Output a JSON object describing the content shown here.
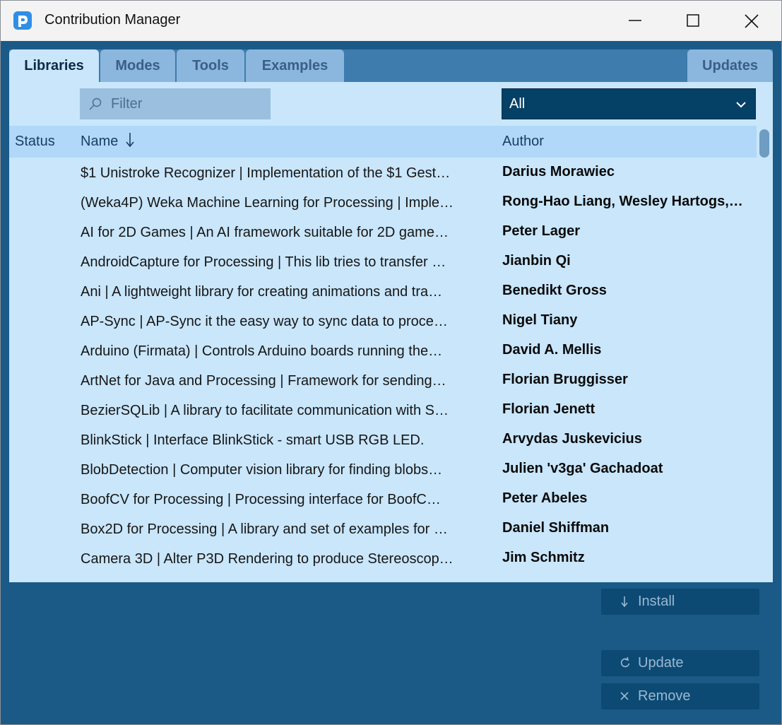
{
  "window": {
    "title": "Contribution Manager"
  },
  "tabs": {
    "libraries": "Libraries",
    "modes": "Modes",
    "tools": "Tools",
    "examples": "Examples",
    "updates": "Updates"
  },
  "filter": {
    "placeholder": "Filter"
  },
  "category": {
    "selected": "All"
  },
  "table": {
    "headers": {
      "status": "Status",
      "name": "Name",
      "author": "Author"
    },
    "sort_indicator": "descending",
    "rows": [
      {
        "name": "$1 Unistroke Recognizer | Implementation of the $1 Gest…",
        "author": "Darius Morawiec"
      },
      {
        "name": "(Weka4P) Weka Machine Learning for Processing | Imple…",
        "author": "Rong-Hao Liang, Wesley Hartogs,…"
      },
      {
        "name": "AI for 2D Games | An AI framework suitable for 2D game…",
        "author": "Peter Lager"
      },
      {
        "name": "AndroidCapture for Processing | This lib tries to transfer …",
        "author": "Jianbin Qi"
      },
      {
        "name": "Ani | A lightweight library for creating animations and tra…",
        "author": "Benedikt Gross"
      },
      {
        "name": "AP-Sync | AP-Sync it the easy way to sync data to proce…",
        "author": "Nigel Tiany"
      },
      {
        "name": "Arduino (Firmata) | Controls Arduino boards running the…",
        "author": "David A. Mellis"
      },
      {
        "name": "ArtNet for Java and Processing | Framework for sending…",
        "author": "Florian Bruggisser"
      },
      {
        "name": "BezierSQLib | A library to facilitate communication with S…",
        "author": "Florian Jenett"
      },
      {
        "name": "BlinkStick | Interface BlinkStick - smart USB RGB LED.",
        "author": "Arvydas Juskevicius"
      },
      {
        "name": "BlobDetection | Computer vision library for finding blobs…",
        "author": "Julien 'v3ga' Gachadoat"
      },
      {
        "name": "BoofCV for Processing | Processing interface for BoofC…",
        "author": "Peter Abeles"
      },
      {
        "name": "Box2D for Processing | A library and set of examples for …",
        "author": "Daniel Shiffman"
      },
      {
        "name": "Camera 3D | Alter P3D Rendering to produce Stereoscop…",
        "author": "Jim Schmitz"
      }
    ]
  },
  "actions": {
    "install": "Install",
    "update": "Update",
    "remove": "Remove"
  },
  "colors": {
    "accent_dark": "#054066",
    "panel_bg": "#c9e6fb",
    "header_bg": "#b1d8f8",
    "action_bg": "#1b5a87",
    "tab_inactive": "#8bb6dd"
  }
}
